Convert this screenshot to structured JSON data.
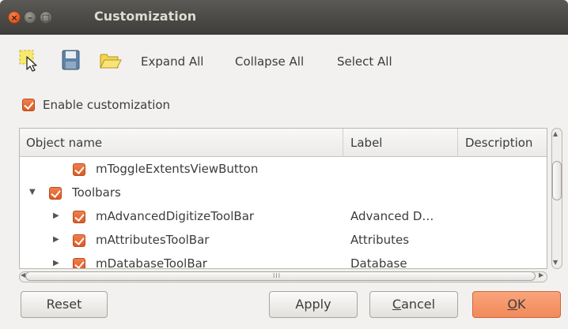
{
  "window": {
    "title": "Customization",
    "controls": {
      "close": "×",
      "minimize": "–",
      "maximize": "□"
    }
  },
  "toolbar": {
    "icons": [
      "select-widget-icon",
      "save-icon",
      "open-folder-icon"
    ],
    "expand_all": "Expand All",
    "collapse_all": "Collapse All",
    "select_all": "Select All"
  },
  "enable_customization": {
    "label": "Enable customization",
    "checked": true
  },
  "tree": {
    "columns": [
      "Object name",
      "Label",
      "Description"
    ],
    "rows": [
      {
        "name": "mToggleExtentsViewButton",
        "label": "",
        "expander": "",
        "checked": true
      },
      {
        "name": "Toolbars",
        "label": "",
        "expander": "▼",
        "checked": true
      },
      {
        "name": "mAdvancedDigitizeToolBar",
        "label": "Advanced D…",
        "expander": "▶",
        "checked": true
      },
      {
        "name": "mAttributesToolBar",
        "label": "Attributes",
        "expander": "▶",
        "checked": true
      },
      {
        "name": "mDatabaseToolBar",
        "label": "Database",
        "expander": "▶",
        "checked": true
      }
    ]
  },
  "scroll": {
    "up": "▲",
    "down": "▼",
    "left": "◀",
    "right": "▶",
    "grip": "III"
  },
  "buttons": {
    "reset": "Reset",
    "apply": "Apply",
    "cancel_underlined": "C",
    "cancel_rest": "ancel",
    "ok_underlined": "O",
    "ok_rest": "K"
  },
  "colors": {
    "accent": "#e8642c",
    "ok_button": "#f59466",
    "titlebar": "#3e3d39"
  }
}
